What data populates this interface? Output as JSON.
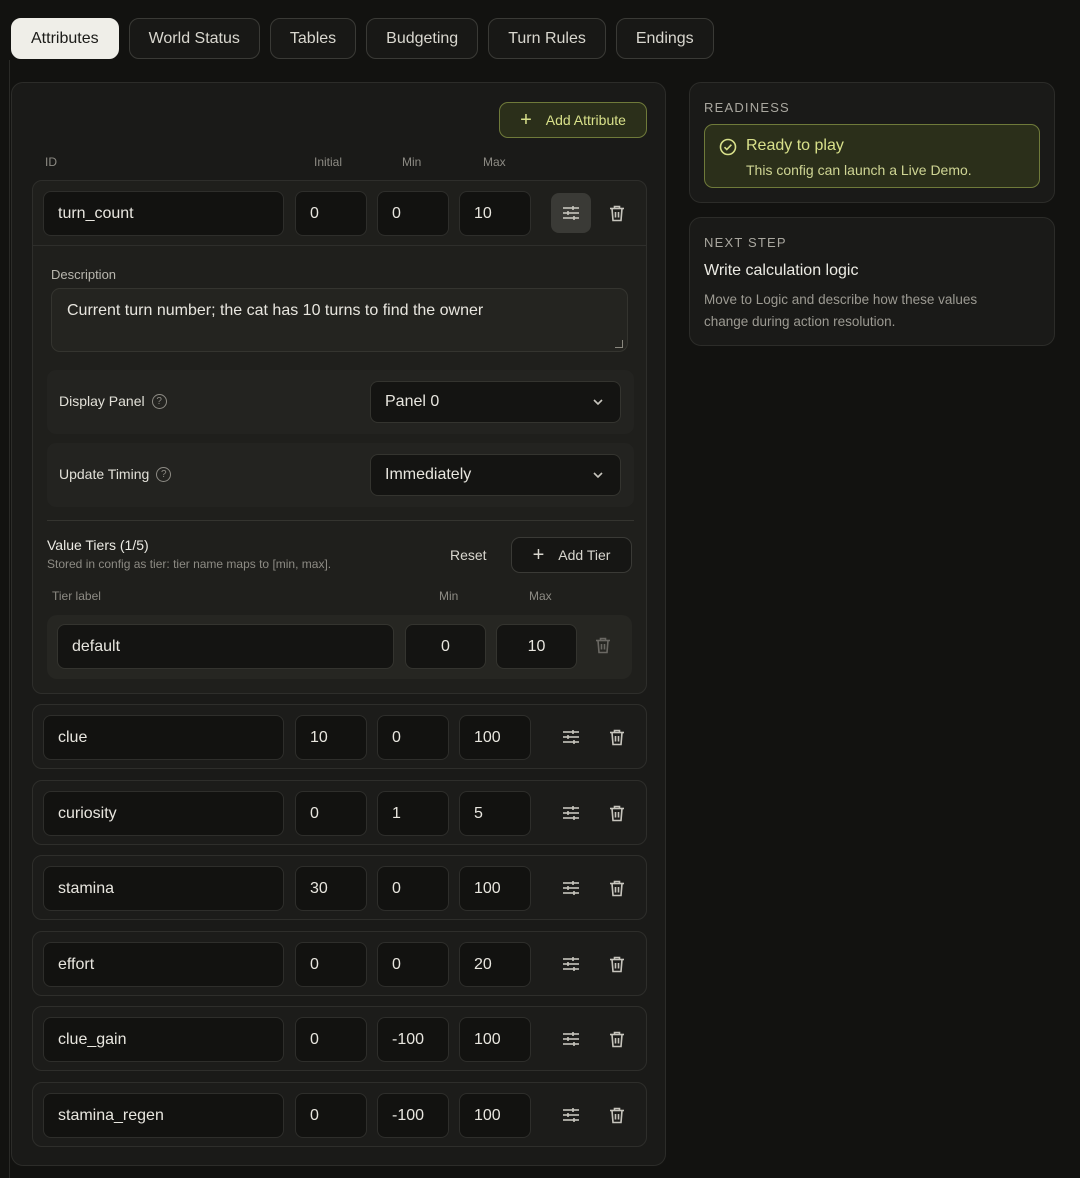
{
  "tabs": [
    {
      "label": "Attributes",
      "active": true
    },
    {
      "label": "World Status"
    },
    {
      "label": "Tables"
    },
    {
      "label": "Budgeting"
    },
    {
      "label": "Turn Rules"
    },
    {
      "label": "Endings"
    }
  ],
  "toolbar": {
    "add_attribute_label": "Add Attribute"
  },
  "columns": {
    "id": "ID",
    "initial": "Initial",
    "min": "Min",
    "max": "Max"
  },
  "expanded": {
    "id": "turn_count",
    "initial": "0",
    "min": "0",
    "max": "10",
    "description_label": "Description",
    "description": "Current turn number; the cat has 10 turns to find the owner",
    "display_panel_label": "Display Panel",
    "display_panel_value": "Panel 0",
    "update_timing_label": "Update Timing",
    "update_timing_value": "Immediately",
    "tiers_title": "Value Tiers (1/5)",
    "tiers_subtitle": "Stored in config as tier: tier name maps to [min, max].",
    "reset_label": "Reset",
    "add_tier_label": "Add Tier",
    "tier_columns": {
      "label": "Tier label",
      "min": "Min",
      "max": "Max"
    },
    "tiers": [
      {
        "label": "default",
        "min": "0",
        "max": "10"
      }
    ]
  },
  "attributes": [
    {
      "id": "clue",
      "initial": "10",
      "min": "0",
      "max": "100"
    },
    {
      "id": "curiosity",
      "initial": "0",
      "min": "1",
      "max": "5"
    },
    {
      "id": "stamina",
      "initial": "30",
      "min": "0",
      "max": "100"
    },
    {
      "id": "effort",
      "initial": "0",
      "min": "0",
      "max": "20"
    },
    {
      "id": "clue_gain",
      "initial": "0",
      "min": "-100",
      "max": "100"
    },
    {
      "id": "stamina_regen",
      "initial": "0",
      "min": "-100",
      "max": "100"
    }
  ],
  "readiness": {
    "heading": "READINESS",
    "title": "Ready to play",
    "subtitle": "This config can launch a Live Demo."
  },
  "next_step": {
    "heading": "NEXT STEP",
    "title": "Write calculation logic",
    "description": "Move to Logic and describe how these values change during action resolution."
  },
  "colors": {
    "accent": "#d8e08a",
    "accent_bg": "#2b2f1a",
    "background": "#121210"
  }
}
